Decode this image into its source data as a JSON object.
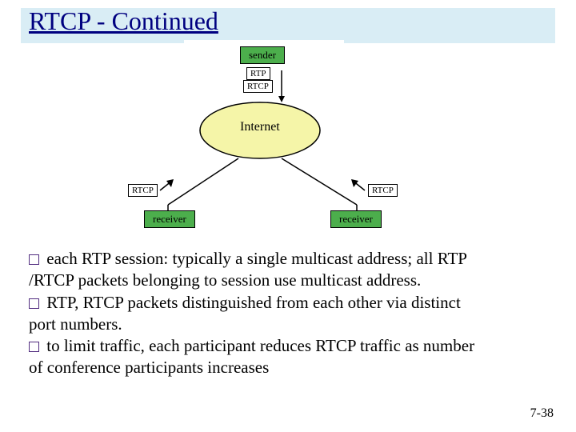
{
  "title": "RTCP - Continued",
  "diagram": {
    "sender_label": "sender",
    "rtp_label": "RTP",
    "rtcp_top_label": "RTCP",
    "cloud_label": "Internet",
    "rtcp_left_label": "RTCP",
    "rtcp_right_label": "RTCP",
    "receiver_left_label": "receiver",
    "receiver_right_label": "receiver"
  },
  "bullets": {
    "text1_a": "each RTP session: typically a single multicast address; all RTP",
    "text1_b": "/RTCP packets belonging to session use multicast address.",
    "text2_a": "RTP, RTCP packets distinguished from each other via distinct",
    "text2_b": "port numbers.",
    "text3_a": "to limit traffic, each participant reduces RTCP traffic as number",
    "text3_b": "of conference participants increases"
  },
  "page_number": "7-38"
}
